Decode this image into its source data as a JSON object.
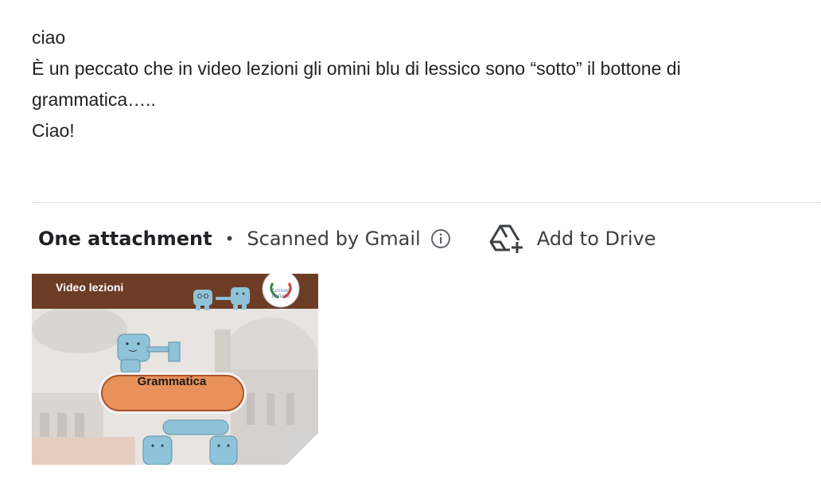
{
  "message": {
    "lines": [
      "ciao",
      "È un peccato che in video lezioni gli omini blu di lessico sono “sotto” il bottone di grammatica…..",
      "Ciao!"
    ]
  },
  "attachments": {
    "count_label": "One attachment",
    "separator": "•",
    "scan_label": "Scanned by Gmail",
    "info_icon": "info-icon",
    "add_to_drive_label": "Add to Drive",
    "drive_icon": "add-to-drive-icon"
  },
  "thumbnail": {
    "header_title": "Video lezioni",
    "button_label": "Grammatica",
    "colors": {
      "header_bar": "#6d3c25",
      "button_fill": "#e8915a",
      "character_blue": "#8fc3d9"
    }
  }
}
